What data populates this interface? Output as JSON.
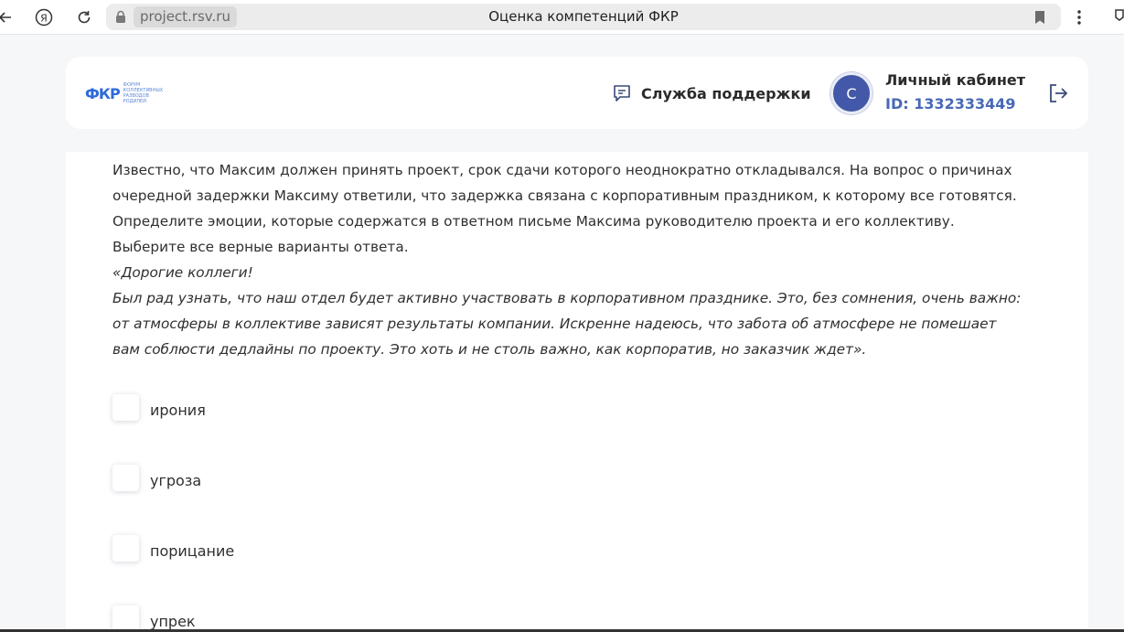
{
  "browser": {
    "url": "project.rsv.ru",
    "tab_title": "Оценка компетенций ФКР"
  },
  "header": {
    "logo_mark": "ФКР",
    "logo_text": "ФОРУМ КОЛЛЕКТИВНЫХ РАЗВОДОВ РОДИЛЕЙ",
    "support_label": "Служба поддержки",
    "avatar_letter": "С",
    "account_title": "Личный кабинет",
    "account_id": "ID: 1332333449"
  },
  "question": {
    "lines": [
      "Известно, что Максим должен принять проект, срок сдачи которого неоднократно откладывался. На вопрос о причинах",
      "очередной задержки Максиму ответили, что задержка связана с корпоративным праздником, к которому все готовятся.",
      "Определите эмоции, которые содержатся в ответном письме Максима руководителю проекта и его коллективу.",
      "Выберите все верные варианты ответа."
    ],
    "letter_lines": [
      "«Дорогие коллеги!",
      "Был рад узнать, что наш отдел будет активно участвовать в корпоративном празднике. Это, без сомнения, очень важно:",
      "от атмосферы в коллективе зависят результаты компании. Искренне надеюсь, что забота об атмосфере не помешает",
      "вам соблюсти дедлайны по проекту. Это хоть и не столь важно, как корпоратив, но заказчик ждет»."
    ]
  },
  "options": [
    {
      "label": "ирония",
      "checked": false
    },
    {
      "label": "угроза",
      "checked": false
    },
    {
      "label": "порицание",
      "checked": false
    },
    {
      "label": "упрек",
      "checked": false
    }
  ],
  "colors": {
    "accent": "#4869b5",
    "avatar": "#4358a8",
    "background": "#f6f7f9"
  }
}
